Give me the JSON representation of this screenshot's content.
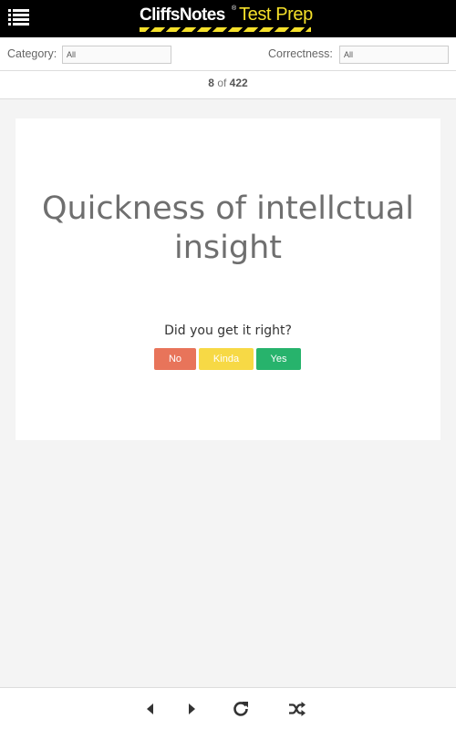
{
  "header": {
    "brand": "CliffsNotes",
    "registered": "®",
    "product": "Test Prep",
    "menu_icon": "list-menu-icon"
  },
  "filters": {
    "category_label": "Category:",
    "category_value": "All",
    "correctness_label": "Correctness:",
    "correctness_value": "All"
  },
  "counter": {
    "current": "8",
    "separator": " of ",
    "total": "422"
  },
  "card": {
    "question": "Quickness of intellctual insight",
    "prompt": "Did you get it right?",
    "buttons": {
      "no": "No",
      "kinda": "Kinda",
      "yes": "Yes"
    }
  },
  "colors": {
    "no": "#e8745a",
    "kinda": "#f7d945",
    "yes": "#27b36c",
    "brand_yellow": "#f5e02a"
  },
  "footer": {
    "icons": [
      "previous-icon",
      "next-icon",
      "refresh-icon",
      "shuffle-icon"
    ]
  }
}
